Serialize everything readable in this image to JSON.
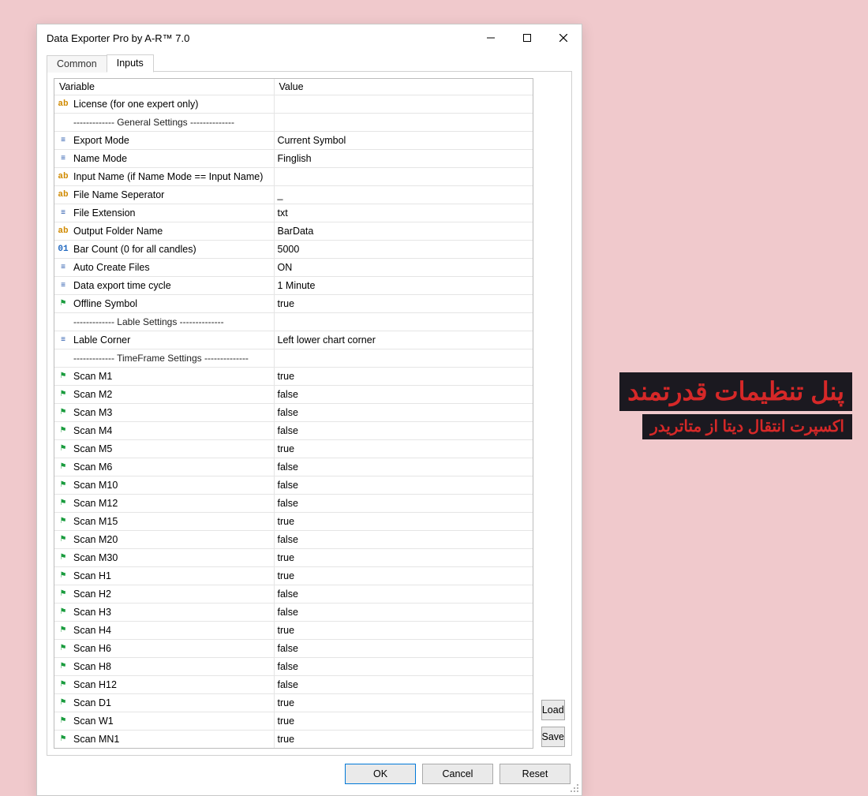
{
  "window": {
    "title": "Data Exporter Pro by A-R™ 7.0"
  },
  "tabs": {
    "common": "Common",
    "inputs": "Inputs"
  },
  "grid": {
    "headers": {
      "variable": "Variable",
      "value": "Value"
    },
    "rows": [
      {
        "icon": "ab",
        "name": "License (for one expert only)",
        "value": ""
      },
      {
        "icon": "",
        "name": "------------- General Settings --------------",
        "value": "",
        "section": true
      },
      {
        "icon": "enum",
        "name": "Export Mode",
        "value": "Current Symbol"
      },
      {
        "icon": "enum",
        "name": "Name Mode",
        "value": "Finglish"
      },
      {
        "icon": "ab",
        "name": "Input Name (if Name Mode == Input Name)",
        "value": ""
      },
      {
        "icon": "ab",
        "name": "File Name Seperator",
        "value": "_"
      },
      {
        "icon": "enum",
        "name": "File Extension",
        "value": "txt"
      },
      {
        "icon": "ab",
        "name": "Output Folder Name",
        "value": "BarData"
      },
      {
        "icon": "num",
        "name": "Bar Count (0 for all candles)",
        "value": "5000"
      },
      {
        "icon": "enum",
        "name": "Auto Create Files",
        "value": "ON"
      },
      {
        "icon": "enum",
        "name": "Data export time cycle",
        "value": "1 Minute"
      },
      {
        "icon": "flag",
        "name": "Offline Symbol",
        "value": "true"
      },
      {
        "icon": "",
        "name": "------------- Lable Settings --------------",
        "value": "",
        "section": true
      },
      {
        "icon": "enum",
        "name": "Lable Corner",
        "value": "Left lower chart corner"
      },
      {
        "icon": "",
        "name": "------------- TimeFrame Settings --------------",
        "value": "",
        "section": true
      },
      {
        "icon": "flag",
        "name": "Scan M1",
        "value": "true"
      },
      {
        "icon": "flag",
        "name": "Scan M2",
        "value": "false"
      },
      {
        "icon": "flag",
        "name": "Scan M3",
        "value": "false"
      },
      {
        "icon": "flag",
        "name": "Scan M4",
        "value": "false"
      },
      {
        "icon": "flag",
        "name": "Scan M5",
        "value": "true"
      },
      {
        "icon": "flag",
        "name": "Scan M6",
        "value": "false"
      },
      {
        "icon": "flag",
        "name": "Scan M10",
        "value": "false"
      },
      {
        "icon": "flag",
        "name": "Scan M12",
        "value": "false"
      },
      {
        "icon": "flag",
        "name": "Scan M15",
        "value": "true"
      },
      {
        "icon": "flag",
        "name": "Scan M20",
        "value": "false"
      },
      {
        "icon": "flag",
        "name": "Scan M30",
        "value": "true"
      },
      {
        "icon": "flag",
        "name": "Scan H1",
        "value": "true"
      },
      {
        "icon": "flag",
        "name": "Scan H2",
        "value": "false"
      },
      {
        "icon": "flag",
        "name": "Scan H3",
        "value": "false"
      },
      {
        "icon": "flag",
        "name": "Scan H4",
        "value": "true"
      },
      {
        "icon": "flag",
        "name": "Scan H6",
        "value": "false"
      },
      {
        "icon": "flag",
        "name": "Scan H8",
        "value": "false"
      },
      {
        "icon": "flag",
        "name": "Scan H12",
        "value": "false"
      },
      {
        "icon": "flag",
        "name": "Scan D1",
        "value": "true"
      },
      {
        "icon": "flag",
        "name": "Scan W1",
        "value": "true"
      },
      {
        "icon": "flag",
        "name": "Scan MN1",
        "value": "true"
      }
    ]
  },
  "buttons": {
    "load": "Load",
    "save": "Save",
    "ok": "OK",
    "cancel": "Cancel",
    "reset": "Reset"
  },
  "overlay": {
    "line1": "پنل تنظیمات قدرتمند",
    "line2": "اکسپرت انتقال دیتا از متاتریدر"
  }
}
